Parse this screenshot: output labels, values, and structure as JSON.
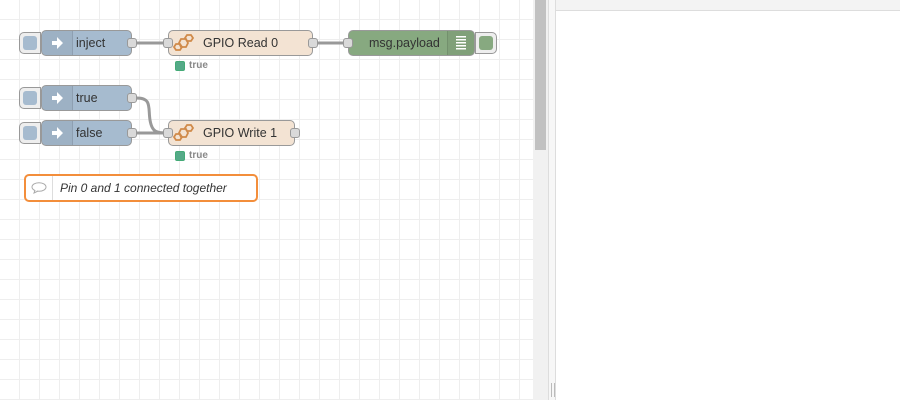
{
  "flow": {
    "nodes": {
      "inject": {
        "label": "inject",
        "icon": "arrow-in-icon"
      },
      "gpio_read": {
        "label": "GPIO Read 0",
        "icon": "gpio-icon",
        "status": "true"
      },
      "debug": {
        "label": "msg.payload",
        "icon": "list-icon"
      },
      "inject_true": {
        "label": "true",
        "icon": "arrow-in-icon"
      },
      "inject_false": {
        "label": "false",
        "icon": "arrow-in-icon"
      },
      "gpio_write": {
        "label": "GPIO Write 1",
        "icon": "gpio-icon",
        "status": "true"
      }
    },
    "comment": {
      "label": "Pin 0 and 1 connected together",
      "icon": "comment-icon"
    }
  },
  "colors": {
    "inject": "#a6bbcf",
    "gpio": "#f3e3d3",
    "debug": "#87a980",
    "comment_border": "#f38e3b",
    "status_ok": "#55aa88"
  }
}
